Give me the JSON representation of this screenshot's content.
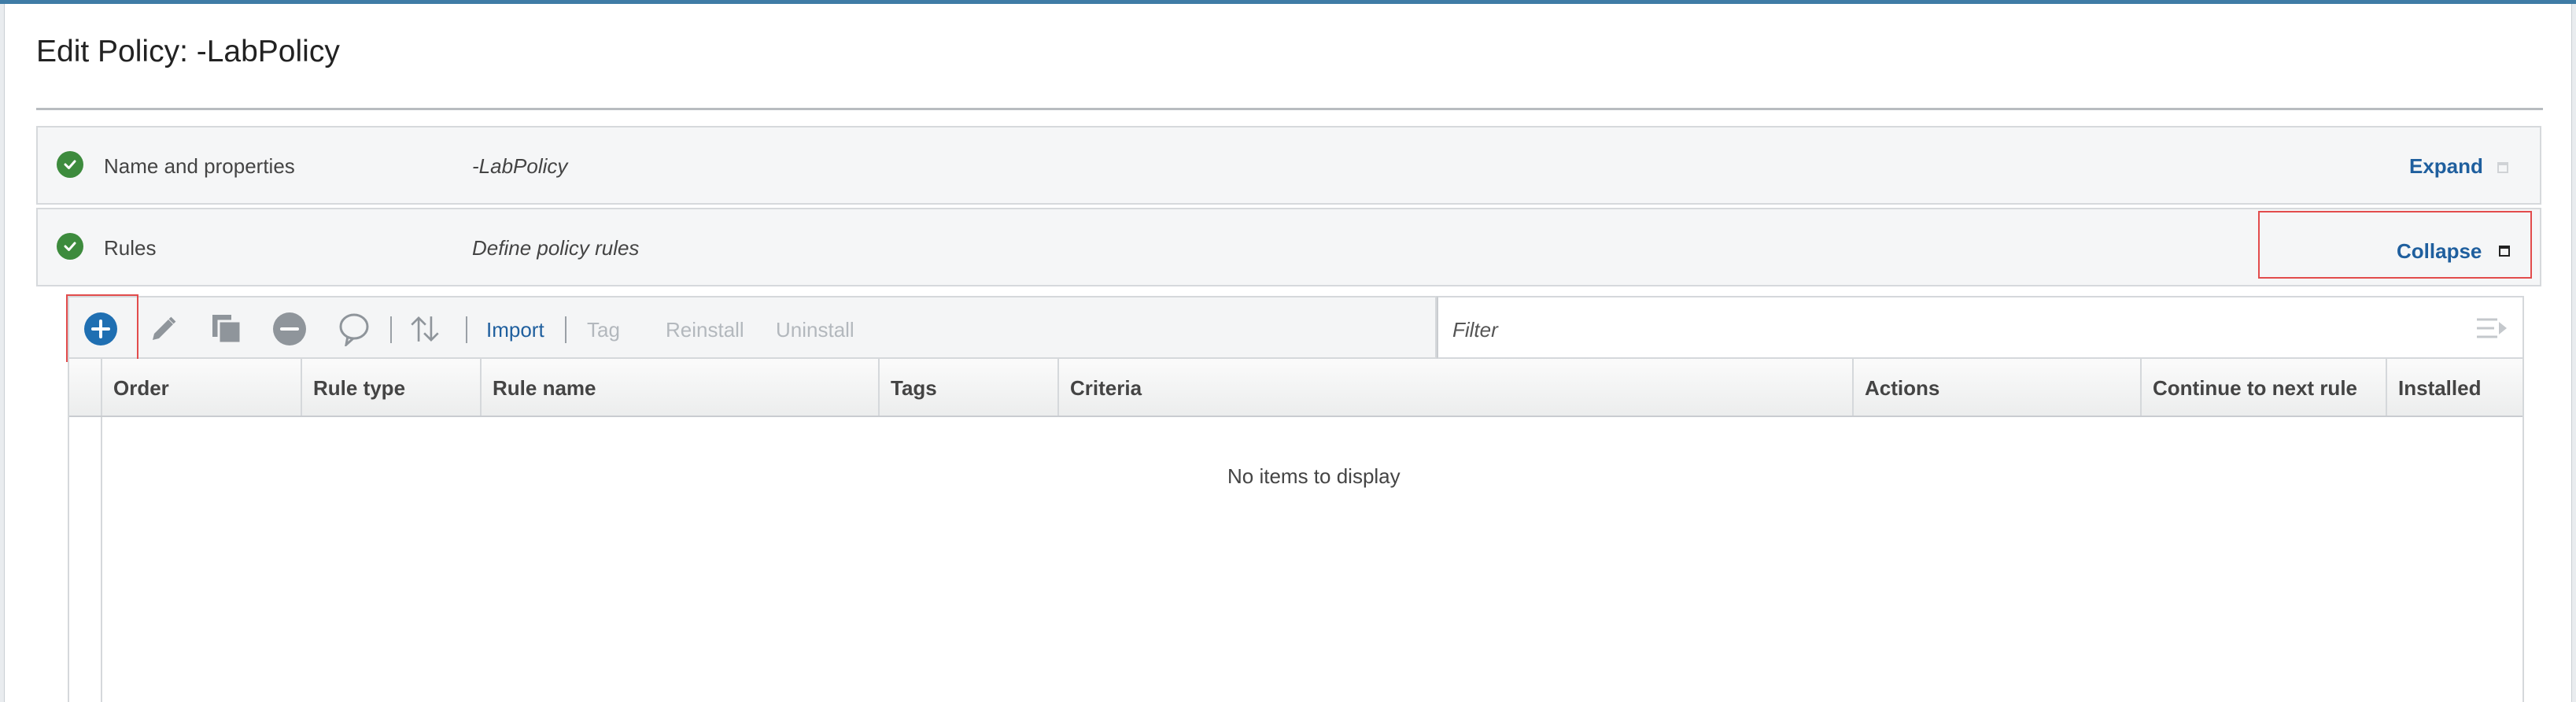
{
  "dialog": {
    "title": "Edit Policy: -LabPolicy"
  },
  "sections": [
    {
      "name": "Name and properties",
      "description": "-LabPolicy",
      "toggle_label": "Expand"
    },
    {
      "name": "Rules",
      "description": "Define policy rules",
      "toggle_label": "Collapse"
    }
  ],
  "toolbar": {
    "icons": [
      "add-icon",
      "edit-icon",
      "copy-icon",
      "remove-icon",
      "comment-icon",
      "reorder-icon"
    ],
    "import_label": "Import",
    "tag_label": "Tag",
    "reinstall_label": "Reinstall",
    "uninstall_label": "Uninstall"
  },
  "filter": {
    "placeholder": "Filter"
  },
  "grid": {
    "columns": [
      "Order",
      "Rule type",
      "Rule name",
      "Tags",
      "Criteria",
      "Actions",
      "Continue to next rule",
      "Installed"
    ],
    "empty_message": "No items to display"
  },
  "colors": {
    "accent": "#1f5f9e",
    "highlight": "#e24c4c",
    "success": "#3d8b3d",
    "add_button": "#1f6fb2"
  }
}
